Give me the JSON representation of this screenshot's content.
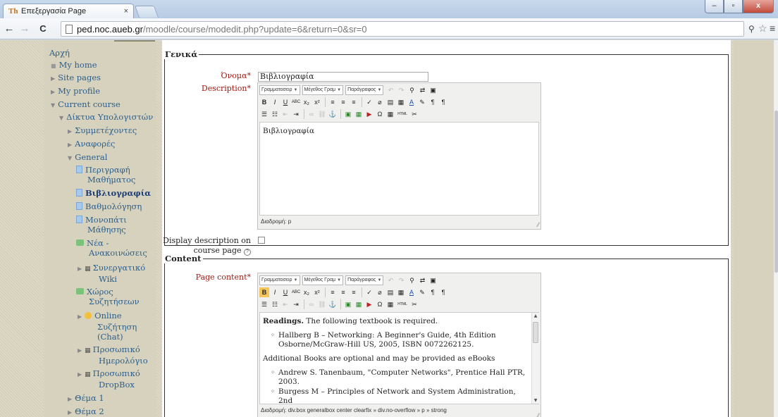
{
  "browser": {
    "tab_favicon": "Th",
    "tab_title": "Επεξεργασία Page",
    "tab_close": "×",
    "url_host": "ped.noc.aueb.gr",
    "url_path": "/moodle/course/modedit.php?update=6&return=0&sr=0",
    "window_buttons": {
      "minimize": "–",
      "maximize": "▫",
      "close": "x"
    },
    "nav": {
      "back": "←",
      "forward": "→",
      "reload": "C"
    },
    "icons": {
      "zoom": "zoom-icon",
      "star": "star-icon",
      "menu": "menu-icon"
    }
  },
  "sidebar": {
    "items": [
      {
        "label": "Αρχή"
      },
      {
        "label": "My home"
      },
      {
        "label": "Site pages"
      },
      {
        "label": "My profile"
      },
      {
        "label": "Current course"
      },
      {
        "label": "Δίκτυα Υπολογιστών"
      },
      {
        "label": "Συμμετέχοντες"
      },
      {
        "label": "Αναφορές"
      },
      {
        "label": "General"
      },
      {
        "label": "Περιγραφή"
      },
      {
        "label": "Μαθήματος"
      },
      {
        "label": "Βιβλιογραφία"
      },
      {
        "label": "Βαθμολόγηση"
      },
      {
        "label": "Μονοπάτι"
      },
      {
        "label": "Μάθησης"
      },
      {
        "label": "Νέα -"
      },
      {
        "label": "Ανακοινώσεις"
      },
      {
        "label": "Συνεργατικό"
      },
      {
        "label": "Wiki"
      },
      {
        "label": "Χώρος"
      },
      {
        "label": "Συζητήσεων"
      },
      {
        "label": "Online"
      },
      {
        "label": "Συζήτηση"
      },
      {
        "label": "(Chat)"
      },
      {
        "label": "Προσωπικό"
      },
      {
        "label": "Ημερολόγιο"
      },
      {
        "label": "Προσωπικό"
      },
      {
        "label": "DropBox"
      },
      {
        "label": "Θέμα 1"
      },
      {
        "label": "Θέμα 2"
      }
    ]
  },
  "general": {
    "legend": "Γενικά",
    "name_label": "Όνομα",
    "name_value": "Βιβλιογραφία",
    "description_label": "Description",
    "description_text": "Βιβλιογραφία",
    "description_path": "Διαδρομή: p",
    "display_label_1": "Display description on",
    "display_label_2": "course page",
    "display_checked": false
  },
  "content": {
    "legend": "Content",
    "page_content_label": "Page content",
    "readings_bold": "Readings.",
    "readings_rest": " The following textbook is required.",
    "book1_line1": "Hallberg B – Networking: A Beginner's Guide, 4th Edition",
    "book1_line2": "Osborne/McGraw-Hill US, 2005, ISBN 0072262125.",
    "additional": "Additional Books are optional and may be provided as eBooks",
    "book2_line1": "Andrew S. Tanenbaum, \"Computer Networks\", Prentice Hall PTR,",
    "book2_line2": "2003.",
    "book3_line1": "Burgess M – Principles of Network and System Administration, 2nd",
    "path": "Διαδρομή: div.box generalbox center clearfix » div.no-overflow » p » strong"
  },
  "editor_toolbar": {
    "font_family": "Γραμματοσειρ",
    "font_size": "Μέγεθος Γραμ",
    "paragraph": "Παράγραφος",
    "row1": [
      "↶",
      "↷",
      "⚲",
      "⇄",
      "▣"
    ],
    "row2": [
      "B",
      "I",
      "U",
      "ABC",
      "x₂",
      "x²",
      "≡",
      "≡",
      "≡",
      "✓",
      "⌀",
      "▤",
      "▦",
      "A",
      "✎",
      "¶",
      "¶"
    ],
    "row3": [
      "☰",
      "☷",
      "⇤",
      "⇥",
      "∞",
      "⛓",
      "⚓",
      "▣",
      "▦",
      "▶",
      "Ω",
      "▦",
      "HTML",
      "✂"
    ]
  },
  "colors": {
    "required_label": "#a3180e",
    "nav_link": "#2c5f8d",
    "sidebar_bg": "#d6d2bd"
  }
}
